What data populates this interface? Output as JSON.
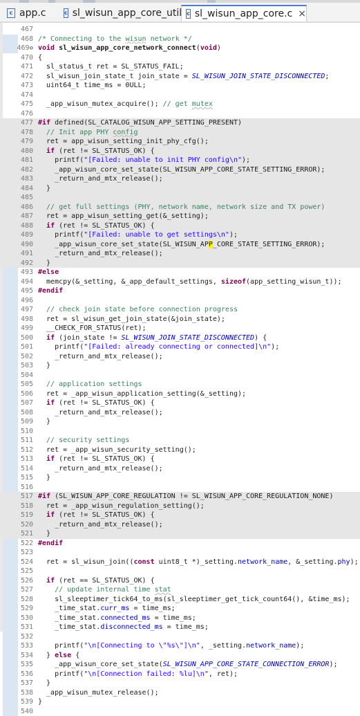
{
  "tabs": [
    {
      "label": "app.c",
      "icon": "c-file-icon",
      "active": false
    },
    {
      "label": "sl_wisun_app_core_util.c",
      "icon": "c-file-icon",
      "active": false
    },
    {
      "label": "sl_wisun_app_core.c",
      "icon": "c-file-icon",
      "active": true,
      "close": "×"
    }
  ],
  "colors": {
    "comment": "#3f7f5f",
    "keyword": "#7f0055",
    "macro": "#0000c0",
    "string": "#2a00ff",
    "inactive_block": "#e6e6e6",
    "active_tab_accent": "#4f7bd0"
  },
  "lines": [
    {
      "n": "467",
      "fold": false,
      "shade": false,
      "segs": []
    },
    {
      "n": "468",
      "fold": false,
      "shade": false,
      "segs": [
        {
          "t": "/* Connecting to the ",
          "c": "cm"
        },
        {
          "t": "wisun",
          "c": "cm uline"
        },
        {
          "t": " network */",
          "c": "cm"
        }
      ]
    },
    {
      "n": "469",
      "fold": true,
      "shade": false,
      "segs": [
        {
          "t": "void ",
          "c": "kw"
        },
        {
          "t": "sl_wisun_app_core_network_connect",
          "c": "fn"
        },
        {
          "t": "(",
          "c": ""
        },
        {
          "t": "void",
          "c": "kw"
        },
        {
          "t": ")",
          "c": ""
        }
      ]
    },
    {
      "n": "470",
      "fold": false,
      "shade": false,
      "segs": [
        {
          "t": "{",
          "c": ""
        }
      ]
    },
    {
      "n": "471",
      "fold": false,
      "shade": false,
      "segs": [
        {
          "t": "  sl_status_t ret = SL_STATUS_FAIL;",
          "c": ""
        }
      ]
    },
    {
      "n": "472",
      "fold": false,
      "shade": false,
      "segs": [
        {
          "t": "  sl_wisun_join_state_t join_state = ",
          "c": ""
        },
        {
          "t": "SL_WISUN_JOIN_STATE_DISCONNECTED",
          "c": "mac"
        },
        {
          "t": ";",
          "c": ""
        }
      ]
    },
    {
      "n": "473",
      "fold": false,
      "shade": false,
      "segs": [
        {
          "t": "  uint64_t time_ms = 0ULL;",
          "c": ""
        }
      ]
    },
    {
      "n": "474",
      "fold": false,
      "shade": false,
      "segs": []
    },
    {
      "n": "475",
      "fold": false,
      "shade": false,
      "segs": [
        {
          "t": "  _app_wisun_mutex_acquire(); ",
          "c": ""
        },
        {
          "t": "// get ",
          "c": "cm"
        },
        {
          "t": "mutex",
          "c": "cm uline"
        }
      ]
    },
    {
      "n": "476",
      "fold": false,
      "shade": false,
      "segs": []
    },
    {
      "n": "477",
      "fold": false,
      "shade": true,
      "segs": [
        {
          "t": "#if ",
          "c": "kw"
        },
        {
          "t": "defined(SL_CATALOG_WISUN_APP_SETTING_PRESENT)",
          "c": ""
        }
      ]
    },
    {
      "n": "478",
      "fold": false,
      "shade": true,
      "segs": [
        {
          "t": "  // Init app PHY ",
          "c": "cm"
        },
        {
          "t": "config",
          "c": "cm uline"
        }
      ]
    },
    {
      "n": "479",
      "fold": false,
      "shade": true,
      "segs": [
        {
          "t": "  ret = app_wisun_setting_init_phy_cfg();",
          "c": ""
        }
      ]
    },
    {
      "n": "480",
      "fold": false,
      "shade": true,
      "segs": [
        {
          "t": "  ",
          "c": ""
        },
        {
          "t": "if",
          "c": "kw"
        },
        {
          "t": " (ret != SL_STATUS_OK) {",
          "c": ""
        }
      ]
    },
    {
      "n": "481",
      "fold": false,
      "shade": true,
      "segs": [
        {
          "t": "    printf(",
          "c": ""
        },
        {
          "t": "\"[Failed: unable to init PHY config\\n\"",
          "c": "str"
        },
        {
          "t": ");",
          "c": ""
        }
      ]
    },
    {
      "n": "482",
      "fold": false,
      "shade": true,
      "segs": [
        {
          "t": "    _app_wisun_core_set_state(SL_WISUN_APP_CORE_STATE_SETTING_ERROR);",
          "c": ""
        }
      ]
    },
    {
      "n": "483",
      "fold": false,
      "shade": true,
      "segs": [
        {
          "t": "    _return_and_mtx_release();",
          "c": ""
        }
      ]
    },
    {
      "n": "484",
      "fold": false,
      "shade": true,
      "segs": [
        {
          "t": "  }",
          "c": ""
        }
      ]
    },
    {
      "n": "485",
      "fold": false,
      "shade": true,
      "segs": []
    },
    {
      "n": "486",
      "fold": false,
      "shade": true,
      "segs": [
        {
          "t": "  // get full settings (PHY, network name, network size and TX power)",
          "c": "cm"
        }
      ]
    },
    {
      "n": "487",
      "fold": false,
      "shade": true,
      "segs": [
        {
          "t": "  ret = app_wisun_setting_get(&_setting);",
          "c": ""
        }
      ]
    },
    {
      "n": "488",
      "fold": false,
      "shade": true,
      "segs": [
        {
          "t": "  ",
          "c": ""
        },
        {
          "t": "if",
          "c": "kw"
        },
        {
          "t": " (ret != SL_STATUS_OK) {",
          "c": ""
        }
      ]
    },
    {
      "n": "489",
      "fold": false,
      "shade": true,
      "segs": [
        {
          "t": "    printf(",
          "c": ""
        },
        {
          "t": "\"[Failed: unable to get settings\\n\"",
          "c": "str"
        },
        {
          "t": ");",
          "c": ""
        }
      ]
    },
    {
      "n": "490",
      "fold": false,
      "shade": true,
      "segs": [
        {
          "t": "    _app_wisun_core_set_state(SL_WISUN_AP",
          "c": ""
        },
        {
          "t": "P",
          "c": "caret"
        },
        {
          "t": "_CORE_STATE_SETTING_ERROR);",
          "c": ""
        }
      ]
    },
    {
      "n": "491",
      "fold": false,
      "shade": true,
      "segs": [
        {
          "t": "    _return_and_mtx_release();",
          "c": ""
        }
      ]
    },
    {
      "n": "492",
      "fold": false,
      "shade": true,
      "segs": [
        {
          "t": "  }",
          "c": ""
        }
      ]
    },
    {
      "n": "493",
      "fold": false,
      "shade": false,
      "segs": [
        {
          "t": "#else",
          "c": "kw"
        }
      ]
    },
    {
      "n": "494",
      "fold": false,
      "shade": false,
      "segs": [
        {
          "t": "  memcpy(&_setting, &_app_default_settings, ",
          "c": ""
        },
        {
          "t": "sizeof",
          "c": "kw"
        },
        {
          "t": "(app_setting_wisun_t));",
          "c": ""
        }
      ]
    },
    {
      "n": "495",
      "fold": false,
      "shade": false,
      "segs": [
        {
          "t": "#endif",
          "c": "kw"
        }
      ]
    },
    {
      "n": "496",
      "fold": false,
      "shade": false,
      "segs": []
    },
    {
      "n": "497",
      "fold": false,
      "shade": false,
      "segs": [
        {
          "t": "  // check join state before connection progress",
          "c": "cm"
        }
      ]
    },
    {
      "n": "498",
      "fold": false,
      "shade": false,
      "segs": [
        {
          "t": "  ret = sl_wisun_get_join_state(&join_state);",
          "c": ""
        }
      ]
    },
    {
      "n": "499",
      "fold": false,
      "shade": false,
      "segs": [
        {
          "t": "  __CHECK_FOR_STATUS(ret);",
          "c": ""
        }
      ]
    },
    {
      "n": "500",
      "fold": false,
      "shade": false,
      "segs": [
        {
          "t": "  ",
          "c": ""
        },
        {
          "t": "if",
          "c": "kw"
        },
        {
          "t": " (join_state != ",
          "c": ""
        },
        {
          "t": "SL_WISUN_JOIN_STATE_DISCONNECTED",
          "c": "mac"
        },
        {
          "t": ") {",
          "c": ""
        }
      ]
    },
    {
      "n": "501",
      "fold": false,
      "shade": false,
      "segs": [
        {
          "t": "    printf(",
          "c": ""
        },
        {
          "t": "\"[Failed: already connecting or connected]\\n\"",
          "c": "str"
        },
        {
          "t": ");",
          "c": ""
        }
      ]
    },
    {
      "n": "502",
      "fold": false,
      "shade": false,
      "segs": [
        {
          "t": "    _return_and_mtx_release();",
          "c": ""
        }
      ]
    },
    {
      "n": "503",
      "fold": false,
      "shade": false,
      "segs": [
        {
          "t": "  }",
          "c": ""
        }
      ]
    },
    {
      "n": "504",
      "fold": false,
      "shade": false,
      "segs": []
    },
    {
      "n": "505",
      "fold": false,
      "shade": false,
      "segs": [
        {
          "t": "  // application settings",
          "c": "cm"
        }
      ]
    },
    {
      "n": "506",
      "fold": false,
      "shade": false,
      "segs": [
        {
          "t": "  ret = _app_wisun_application_setting(&_setting);",
          "c": ""
        }
      ]
    },
    {
      "n": "507",
      "fold": false,
      "shade": false,
      "segs": [
        {
          "t": "  ",
          "c": ""
        },
        {
          "t": "if",
          "c": "kw"
        },
        {
          "t": " (ret != SL_STATUS_OK) {",
          "c": ""
        }
      ]
    },
    {
      "n": "508",
      "fold": false,
      "shade": false,
      "segs": [
        {
          "t": "    _return_and_mtx_release();",
          "c": ""
        }
      ]
    },
    {
      "n": "509",
      "fold": false,
      "shade": false,
      "segs": [
        {
          "t": "  }",
          "c": ""
        }
      ]
    },
    {
      "n": "510",
      "fold": false,
      "shade": false,
      "segs": []
    },
    {
      "n": "511",
      "fold": false,
      "shade": false,
      "segs": [
        {
          "t": "  // security settings",
          "c": "cm"
        }
      ]
    },
    {
      "n": "512",
      "fold": false,
      "shade": false,
      "segs": [
        {
          "t": "  ret = _app_wisun_security_setting();",
          "c": ""
        }
      ]
    },
    {
      "n": "513",
      "fold": false,
      "shade": false,
      "segs": [
        {
          "t": "  ",
          "c": ""
        },
        {
          "t": "if",
          "c": "kw"
        },
        {
          "t": " (ret != SL_STATUS_OK) {",
          "c": ""
        }
      ]
    },
    {
      "n": "514",
      "fold": false,
      "shade": false,
      "segs": [
        {
          "t": "    _return_and_mtx_release();",
          "c": ""
        }
      ]
    },
    {
      "n": "515",
      "fold": false,
      "shade": false,
      "segs": [
        {
          "t": "  }",
          "c": ""
        }
      ]
    },
    {
      "n": "516",
      "fold": false,
      "shade": false,
      "segs": []
    },
    {
      "n": "517",
      "fold": false,
      "shade": true,
      "segs": [
        {
          "t": "#if ",
          "c": "kw"
        },
        {
          "t": "(SL_WISUN_APP_CORE_REGULATION != SL_WISUN_APP_CORE_REGULATION_NONE)",
          "c": ""
        }
      ]
    },
    {
      "n": "518",
      "fold": false,
      "shade": true,
      "segs": [
        {
          "t": "  ret = _app_wisun_regulation_setting();",
          "c": ""
        }
      ]
    },
    {
      "n": "519",
      "fold": false,
      "shade": true,
      "segs": [
        {
          "t": "  ",
          "c": ""
        },
        {
          "t": "if",
          "c": "kw"
        },
        {
          "t": " (ret != SL_STATUS_OK) {",
          "c": ""
        }
      ]
    },
    {
      "n": "520",
      "fold": false,
      "shade": true,
      "segs": [
        {
          "t": "    _return_and_mtx_release();",
          "c": ""
        }
      ]
    },
    {
      "n": "521",
      "fold": false,
      "shade": true,
      "segs": [
        {
          "t": "  }",
          "c": ""
        }
      ]
    },
    {
      "n": "522",
      "fold": false,
      "shade": false,
      "segs": [
        {
          "t": "#endif",
          "c": "kw"
        }
      ]
    },
    {
      "n": "523",
      "fold": false,
      "shade": false,
      "segs": []
    },
    {
      "n": "524",
      "fold": false,
      "shade": false,
      "segs": [
        {
          "t": "  ret = sl_wisun_join((",
          "c": ""
        },
        {
          "t": "const",
          "c": "kw"
        },
        {
          "t": " uint8_t *)_setting.",
          "c": ""
        },
        {
          "t": "network_name",
          "c": "fld"
        },
        {
          "t": ", &_setting.",
          "c": ""
        },
        {
          "t": "phy",
          "c": "fld"
        },
        {
          "t": ");",
          "c": ""
        }
      ]
    },
    {
      "n": "525",
      "fold": false,
      "shade": false,
      "segs": []
    },
    {
      "n": "526",
      "fold": false,
      "shade": false,
      "segs": [
        {
          "t": "  ",
          "c": ""
        },
        {
          "t": "if",
          "c": "kw"
        },
        {
          "t": " (ret == SL_STATUS_OK) {",
          "c": ""
        }
      ]
    },
    {
      "n": "527",
      "fold": false,
      "shade": false,
      "segs": [
        {
          "t": "    // update internal time ",
          "c": "cm"
        },
        {
          "t": "stat",
          "c": "cm uline"
        }
      ]
    },
    {
      "n": "528",
      "fold": false,
      "shade": false,
      "segs": [
        {
          "t": "    sl_sleeptimer_tick64_to_ms(sl_sleeptimer_get_tick_count64(), &time_ms);",
          "c": ""
        }
      ]
    },
    {
      "n": "529",
      "fold": false,
      "shade": false,
      "segs": [
        {
          "t": "    _time_stat.",
          "c": ""
        },
        {
          "t": "curr_ms",
          "c": "fld"
        },
        {
          "t": " = time_ms;",
          "c": ""
        }
      ]
    },
    {
      "n": "530",
      "fold": false,
      "shade": false,
      "segs": [
        {
          "t": "    _time_stat.",
          "c": ""
        },
        {
          "t": "connected_ms",
          "c": "fld"
        },
        {
          "t": " = time_ms;",
          "c": ""
        }
      ]
    },
    {
      "n": "531",
      "fold": false,
      "shade": false,
      "segs": [
        {
          "t": "    _time_stat.",
          "c": ""
        },
        {
          "t": "disconnected_ms",
          "c": "fld"
        },
        {
          "t": " = time_ms;",
          "c": ""
        }
      ]
    },
    {
      "n": "532",
      "fold": false,
      "shade": false,
      "segs": []
    },
    {
      "n": "533",
      "fold": false,
      "shade": false,
      "segs": [
        {
          "t": "    printf(",
          "c": ""
        },
        {
          "t": "\"\\n[Connecting to \\\"%s\\\"]\\n\"",
          "c": "str"
        },
        {
          "t": ", _setting.",
          "c": ""
        },
        {
          "t": "network_name",
          "c": "fld"
        },
        {
          "t": ");",
          "c": ""
        }
      ]
    },
    {
      "n": "534",
      "fold": false,
      "shade": false,
      "segs": [
        {
          "t": "  } ",
          "c": ""
        },
        {
          "t": "else",
          "c": "kw"
        },
        {
          "t": " {",
          "c": ""
        }
      ]
    },
    {
      "n": "535",
      "fold": false,
      "shade": false,
      "segs": [
        {
          "t": "    _app_wisun_core_set_state(",
          "c": ""
        },
        {
          "t": "SL_WISUN_APP_CORE_STATE_CONNECTION_ERROR",
          "c": "mac"
        },
        {
          "t": ");",
          "c": ""
        }
      ]
    },
    {
      "n": "536",
      "fold": false,
      "shade": false,
      "segs": [
        {
          "t": "    printf(",
          "c": ""
        },
        {
          "t": "\"\\n[Connection failed: %lu]\\n\"",
          "c": "str"
        },
        {
          "t": ", ret);",
          "c": ""
        }
      ]
    },
    {
      "n": "537",
      "fold": false,
      "shade": false,
      "segs": [
        {
          "t": "  }",
          "c": ""
        }
      ]
    },
    {
      "n": "538",
      "fold": false,
      "shade": false,
      "segs": [
        {
          "t": "  _app_wisun_mutex_release();",
          "c": ""
        }
      ]
    },
    {
      "n": "539",
      "fold": false,
      "shade": false,
      "segs": [
        {
          "t": "}",
          "c": ""
        }
      ]
    },
    {
      "n": "540",
      "fold": false,
      "shade": false,
      "segs": []
    }
  ]
}
